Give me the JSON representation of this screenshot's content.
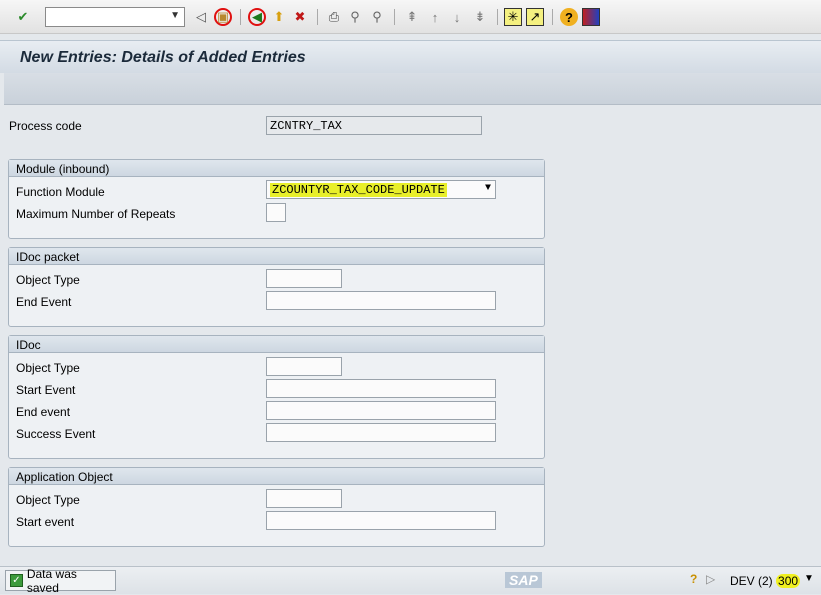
{
  "toolbar": {
    "command_field": "",
    "icons": [
      "enter-icon",
      "back-triangle-icon",
      "save-icon",
      "back-icon",
      "exit-icon",
      "cancel-icon",
      "print-icon",
      "find-icon",
      "find-next-icon",
      "first-page-icon",
      "previous-page-icon",
      "next-page-icon",
      "last-page-icon",
      "new-session-icon",
      "shortcut-icon",
      "help-icon",
      "layout-icon"
    ]
  },
  "header": {
    "title": "New Entries: Details of Added Entries"
  },
  "form": {
    "process_code": {
      "label": "Process code",
      "value": "ZCNTRY_TAX"
    },
    "groups": [
      {
        "title": "Module (inbound)",
        "fields": [
          {
            "label": "Function Module",
            "value": "ZCOUNTYR_TAX_CODE_UPDATE"
          },
          {
            "label": "Maximum Number of Repeats",
            "value": ""
          }
        ]
      },
      {
        "title": "IDoc packet",
        "fields": [
          {
            "label": "Object Type",
            "value": ""
          },
          {
            "label": "End Event",
            "value": ""
          }
        ]
      },
      {
        "title": "IDoc",
        "fields": [
          {
            "label": "Object Type",
            "value": ""
          },
          {
            "label": "Start Event",
            "value": ""
          },
          {
            "label": "End event",
            "value": ""
          },
          {
            "label": "Success Event",
            "value": ""
          }
        ]
      },
      {
        "title": "Application Object",
        "fields": [
          {
            "label": "Object Type",
            "value": ""
          },
          {
            "label": "Start event",
            "value": ""
          }
        ]
      }
    ]
  },
  "status": {
    "message": "Data was saved",
    "logo": "SAP",
    "system": "DEV (2)",
    "client": "300"
  },
  "colors": {
    "highlight": "#e8ef2a",
    "annotation": "#e01010"
  }
}
